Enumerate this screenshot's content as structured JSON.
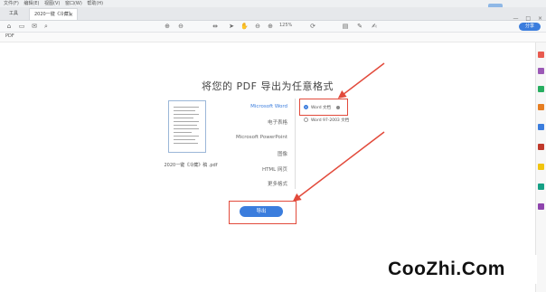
{
  "menubar": {
    "items": [
      "文件(F)",
      "编辑(E)",
      "视图(V)",
      "窗口(W)",
      "帮助(H)"
    ]
  },
  "tabs": {
    "home": "工具",
    "doc": "2020一键《冷藏》",
    "close": "×"
  },
  "window": {
    "controls": [
      "—",
      "□",
      "×"
    ]
  },
  "toolbar": {
    "zoom": "125%",
    "open_label": "分享"
  },
  "subbar": {
    "label": "PDF"
  },
  "main": {
    "title": "将您的 PDF 导出为任意格式",
    "file_name": "2020一键《冷藏》稿 .pdf",
    "formats": [
      "Microsoft Word",
      "电子表格",
      "Microsoft PowerPoint",
      "图像",
      "HTML 网页",
      "更多格式"
    ],
    "options": [
      "Word 文档",
      "Word 97-2003 文档"
    ],
    "export_label": "导出"
  },
  "watermark": "CooZhi.Com",
  "colors": {
    "accent": "#3b7ddd",
    "annotation": "#e24a3b"
  }
}
